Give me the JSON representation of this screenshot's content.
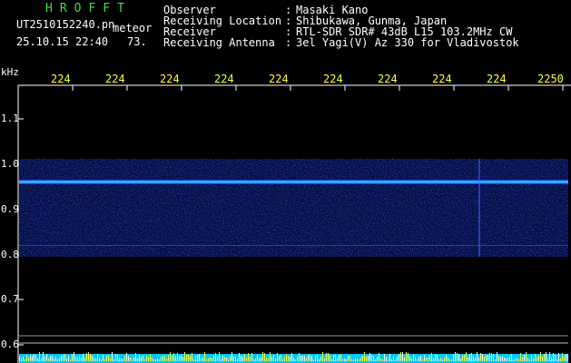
{
  "header": {
    "title": "HROFFT",
    "filename": "UT2510152240.pn",
    "meteor_label": "meteor",
    "datetime": "25.10.15 22:40",
    "count": "73.",
    "info": [
      {
        "label": "Observer",
        "sep": ":",
        "value": "Masaki Kano"
      },
      {
        "label": "Receiving Location",
        "sep": ":",
        "value": "Shibukawa, Gunma, Japan"
      },
      {
        "label": "Receiver",
        "sep": ":",
        "value": "RTL-SDR SDR# 43dB L15 103.2MHz CW"
      },
      {
        "label": "Receiving Antenna",
        "sep": ":",
        "value": "3el Yagi(V) Az 330 for Vladivostok"
      }
    ]
  },
  "axis": {
    "unit": "kHz",
    "time_ticks": [
      "224",
      "224",
      "224",
      "224",
      "224",
      "224",
      "224",
      "224",
      "224",
      "2250"
    ],
    "freq_ticks": [
      "1.1",
      "1.0",
      "0.9",
      "0.8",
      "0.7",
      "0.6"
    ]
  },
  "colors": {
    "background": "#000000",
    "signal_band": "#0a1a8a",
    "carrier": "#40c8ff",
    "axis": "#ffffff",
    "labels": "#ffff33",
    "title": "#3fe03f"
  }
}
